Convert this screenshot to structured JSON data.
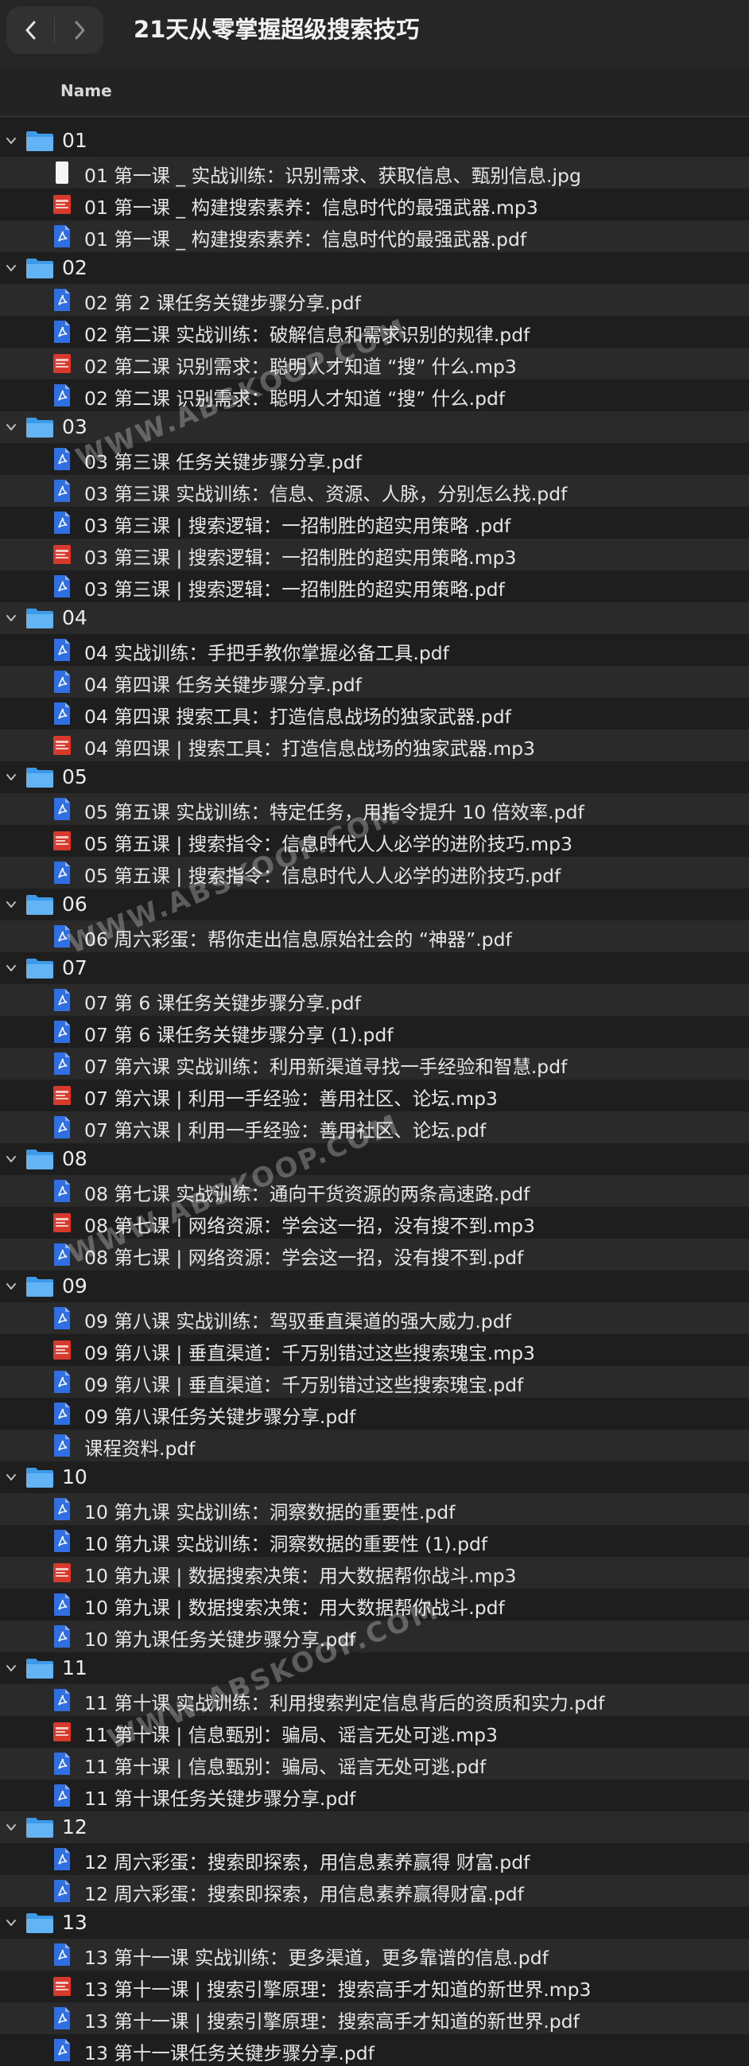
{
  "window": {
    "title": "21天从零掌握超级搜索技巧"
  },
  "header": {
    "column_name": "Name"
  },
  "watermark": "WWW.ABSKOOP.COM",
  "folders": [
    {
      "name": "01",
      "files": [
        {
          "name": "01 第一课 _ 实战训练：识别需求、获取信息、甄别信息.jpg",
          "type": "jpg"
        },
        {
          "name": "01 第一课 _ 构建搜索素养：信息时代的最强武器.mp3",
          "type": "mp3"
        },
        {
          "name": "01 第一课 _ 构建搜索素养：信息时代的最强武器.pdf",
          "type": "pdf"
        }
      ]
    },
    {
      "name": "02",
      "files": [
        {
          "name": "02 第 2 课任务关键步骤分享.pdf",
          "type": "pdf"
        },
        {
          "name": "02 第二课  实战训练：破解信息和需求识别的规律.pdf",
          "type": "pdf"
        },
        {
          "name": "02 第二课 识别需求：聪明人才知道 “搜” 什么.mp3",
          "type": "mp3"
        },
        {
          "name": "02 第二课 识别需求：聪明人才知道 “搜” 什么.pdf",
          "type": "pdf"
        }
      ]
    },
    {
      "name": "03",
      "files": [
        {
          "name": "03 第三课 任务关键步骤分享.pdf",
          "type": "pdf"
        },
        {
          "name": "03 第三课 实战训练：信息、资源、人脉，分别怎么找.pdf",
          "type": "pdf"
        },
        {
          "name": "03 第三课 | 搜索逻辑：一招制胜的超实用策略 .pdf",
          "type": "pdf"
        },
        {
          "name": "03 第三课 | 搜索逻辑：一招制胜的超实用策略.mp3",
          "type": "mp3"
        },
        {
          "name": "03 第三课 | 搜索逻辑：一招制胜的超实用策略.pdf",
          "type": "pdf"
        }
      ]
    },
    {
      "name": "04",
      "files": [
        {
          "name": "04 实战训练：手把手教你掌握必备工具.pdf",
          "type": "pdf"
        },
        {
          "name": "04 第四课 任务关键步骤分享.pdf",
          "type": "pdf"
        },
        {
          "name": "04 第四课 搜索工具：打造信息战场的独家武器.pdf",
          "type": "pdf"
        },
        {
          "name": "04 第四课 | 搜索工具：打造信息战场的独家武器.mp3",
          "type": "mp3"
        }
      ]
    },
    {
      "name": "05",
      "files": [
        {
          "name": "05 第五课 实战训练：特定任务，用指令提升 10 倍效率.pdf",
          "type": "pdf"
        },
        {
          "name": "05 第五课 | 搜索指令：信息时代人人必学的进阶技巧.mp3",
          "type": "mp3"
        },
        {
          "name": "05 第五课 | 搜索指令：信息时代人人必学的进阶技巧.pdf",
          "type": "pdf"
        }
      ]
    },
    {
      "name": "06",
      "files": [
        {
          "name": "06 周六彩蛋：帮你走出信息原始社会的 “神器”.pdf",
          "type": "pdf"
        }
      ]
    },
    {
      "name": "07",
      "files": [
        {
          "name": "07 第 6 课任务关键步骤分享.pdf",
          "type": "pdf"
        },
        {
          "name": "07 第 6 课任务关键步骤分享 (1).pdf",
          "type": "pdf"
        },
        {
          "name": "07 第六课 实战训练：利用新渠道寻找一手经验和智慧.pdf",
          "type": "pdf"
        },
        {
          "name": "07 第六课 | 利用一手经验：善用社区、论坛.mp3",
          "type": "mp3"
        },
        {
          "name": "07 第六课 | 利用一手经验：善用社区、论坛.pdf",
          "type": "pdf"
        }
      ]
    },
    {
      "name": "08",
      "files": [
        {
          "name": "08 第七课 实战训练：通向干货资源的两条高速路.pdf",
          "type": "pdf"
        },
        {
          "name": "08 第七课 | 网络资源：学会这一招，没有搜不到.mp3",
          "type": "mp3"
        },
        {
          "name": "08 第七课 | 网络资源：学会这一招，没有搜不到.pdf",
          "type": "pdf"
        }
      ]
    },
    {
      "name": "09",
      "files": [
        {
          "name": "09 第八课 实战训练：驾驭垂直渠道的强大威力.pdf",
          "type": "pdf"
        },
        {
          "name": "09 第八课 | 垂直渠道：千万别错过这些搜索瑰宝.mp3",
          "type": "mp3"
        },
        {
          "name": "09 第八课 | 垂直渠道：千万别错过这些搜索瑰宝.pdf",
          "type": "pdf"
        },
        {
          "name": "09 第八课任务关键步骤分享.pdf",
          "type": "pdf"
        },
        {
          "name": "课程资料.pdf",
          "type": "pdf"
        }
      ]
    },
    {
      "name": "10",
      "files": [
        {
          "name": "10 第九课 实战训练：洞察数据的重要性.pdf",
          "type": "pdf"
        },
        {
          "name": "10 第九课 实战训练：洞察数据的重要性 (1).pdf",
          "type": "pdf"
        },
        {
          "name": "10 第九课 | 数据搜索决策：用大数据帮你战斗.mp3",
          "type": "mp3"
        },
        {
          "name": "10 第九课 | 数据搜索决策：用大数据帮你战斗.pdf",
          "type": "pdf"
        },
        {
          "name": "10 第九课任务关键步骤分享.pdf",
          "type": "pdf"
        }
      ]
    },
    {
      "name": "11",
      "files": [
        {
          "name": "11 第十课 实战训练：利用搜索判定信息背后的资质和实力.pdf",
          "type": "pdf"
        },
        {
          "name": "11 第十课 | 信息甄别：骗局、谣言无处可逃.mp3",
          "type": "mp3"
        },
        {
          "name": "11 第十课 | 信息甄别：骗局、谣言无处可逃.pdf",
          "type": "pdf"
        },
        {
          "name": "11 第十课任务关键步骤分享.pdf",
          "type": "pdf"
        }
      ]
    },
    {
      "name": "12",
      "files": [
        {
          "name": "12 周六彩蛋：搜索即探索，用信息素养赢得 财富.pdf",
          "type": "pdf"
        },
        {
          "name": "12 周六彩蛋：搜索即探索，用信息素养赢得财富.pdf",
          "type": "pdf"
        }
      ]
    },
    {
      "name": "13",
      "files": [
        {
          "name": "13 第十一课 实战训练：更多渠道，更多靠谱的信息.pdf",
          "type": "pdf"
        },
        {
          "name": "13 第十一课 | 搜索引擎原理：搜索高手才知道的新世界.mp3",
          "type": "mp3"
        },
        {
          "name": "13 第十一课 | 搜索引擎原理：搜索高手才知道的新世界.pdf",
          "type": "pdf"
        },
        {
          "name": "13 第十一课任务关键步骤分享.pdf",
          "type": "pdf"
        }
      ]
    }
  ]
}
